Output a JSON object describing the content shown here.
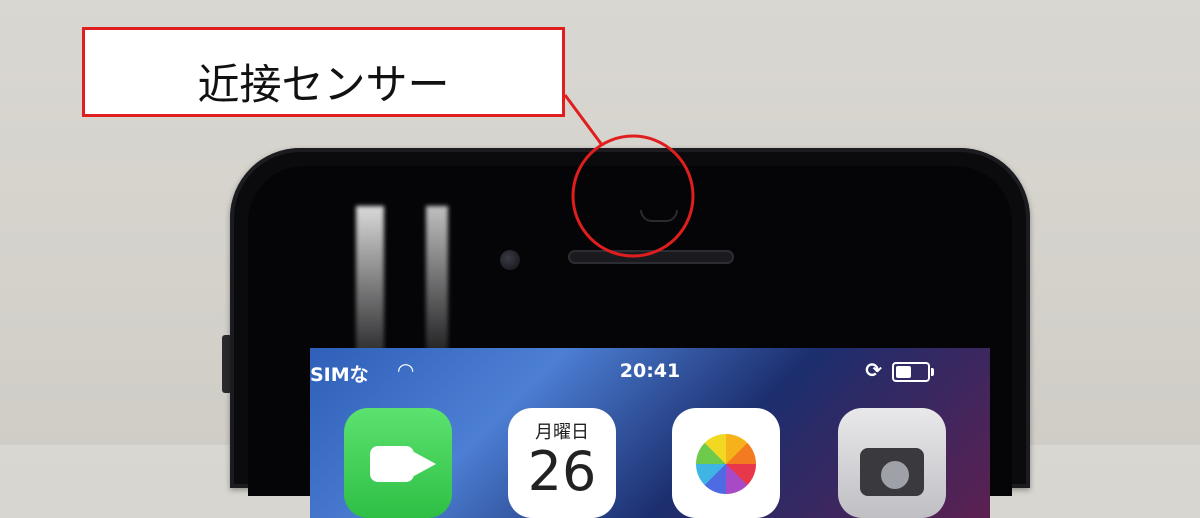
{
  "callout": {
    "label": "近接センサー",
    "color": "#e01e1e"
  },
  "status_bar": {
    "carrier": "SIMな",
    "time": "20:41",
    "battery_level": 0.5
  },
  "apps": [
    {
      "name": "facetime-app-icon"
    },
    {
      "name": "calendar-app-icon",
      "day_label": "月曜日",
      "date": "26"
    },
    {
      "name": "photos-app-icon"
    },
    {
      "name": "camera-app-icon"
    }
  ]
}
